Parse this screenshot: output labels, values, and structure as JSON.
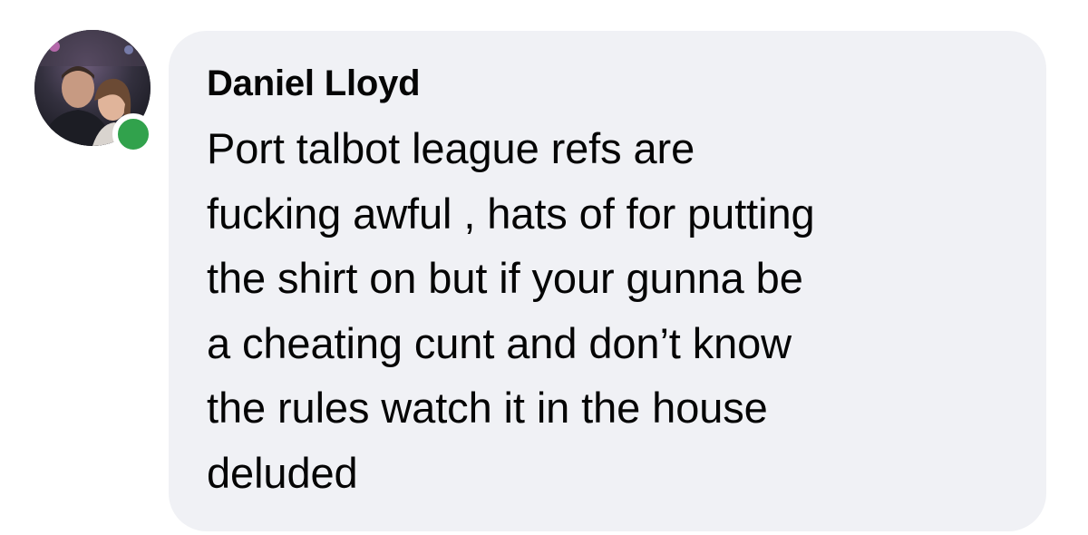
{
  "comment": {
    "author": "Daniel Lloyd",
    "text": "Port talbot league refs are\nfucking awful , hats of for putting\nthe shirt on but if your gunna be\na cheating cunt and don’t know\nthe rules watch it in the house\ndeluded"
  },
  "avatar": {
    "icon": "user-photo-avatar",
    "online_status_color": "#31a24c"
  },
  "colors": {
    "bubble_background": "#f0f1f5",
    "text": "#050505",
    "online": "#31a24c"
  }
}
